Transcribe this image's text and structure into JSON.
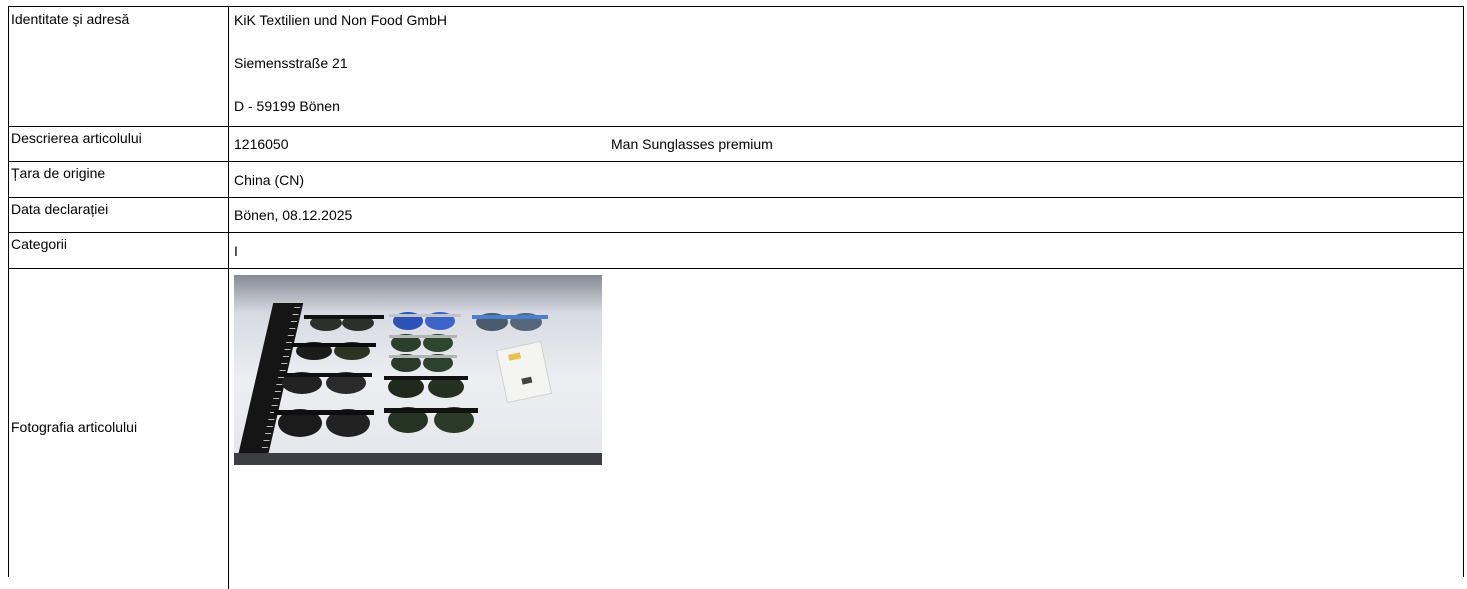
{
  "rows": {
    "identity": {
      "label": "Identitate și adresă",
      "company": "KiK Textilien und Non Food GmbH",
      "street": "Siemensstraße 21",
      "city": "D - 59199 Bönen"
    },
    "description": {
      "label": "Descrierea articolului",
      "article_number": "1216050",
      "article_name": "Man Sunglasses premium"
    },
    "origin": {
      "label": "Țara de origine",
      "value": "China (CN)"
    },
    "date": {
      "label": "Data declarației",
      "value": "Bönen, 08.12.2025"
    },
    "category": {
      "label": "Categorii",
      "value": "I"
    },
    "photo": {
      "label": "Fotografia articolului"
    }
  },
  "colors": {
    "border": "#000000",
    "background": "#ffffff",
    "text": "#000000"
  }
}
